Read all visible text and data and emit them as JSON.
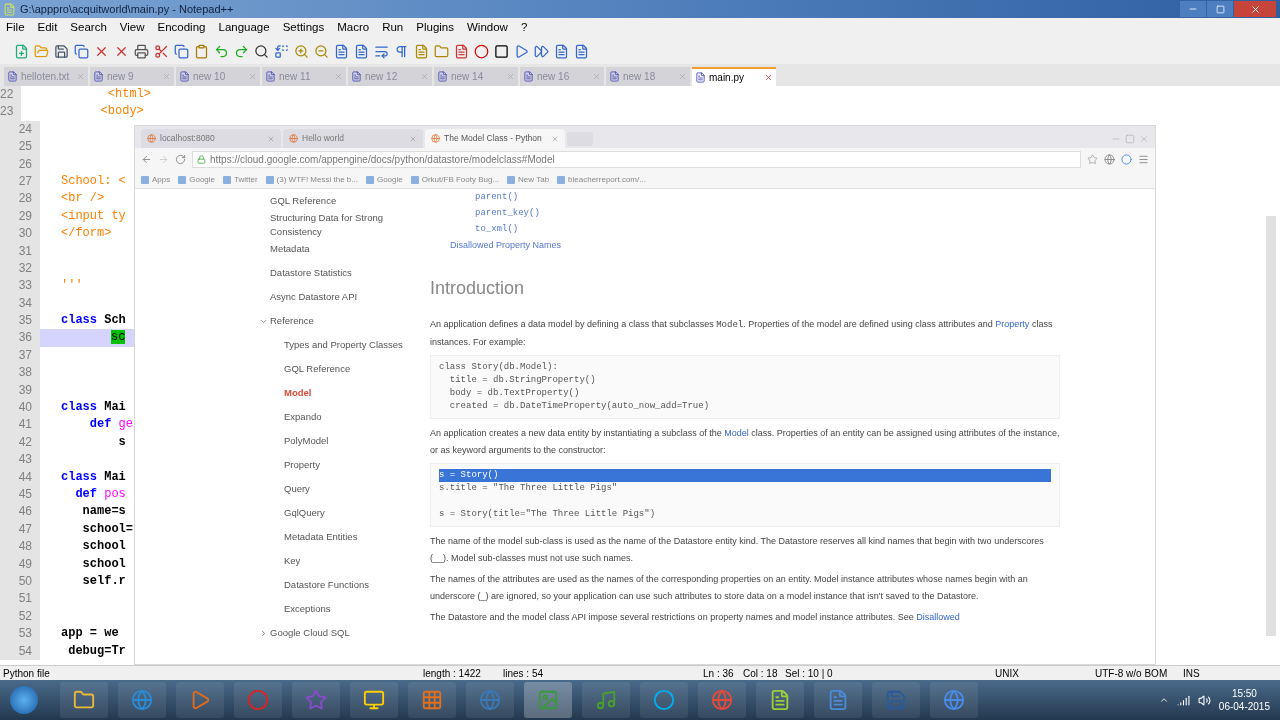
{
  "window": {
    "title": "G:\\apppro\\acquitworld\\main.py - Notepad++"
  },
  "menu": [
    "File",
    "Edit",
    "Search",
    "View",
    "Encoding",
    "Language",
    "Settings",
    "Macro",
    "Run",
    "Plugins",
    "Window",
    "?"
  ],
  "file_tabs": [
    {
      "label": "helloten.txt",
      "selected": false
    },
    {
      "label": "new 9",
      "selected": false
    },
    {
      "label": "new 10",
      "selected": false
    },
    {
      "label": "new 11",
      "selected": false
    },
    {
      "label": "new 12",
      "selected": false
    },
    {
      "label": "new 14",
      "selected": false
    },
    {
      "label": "new 16",
      "selected": false
    },
    {
      "label": "new 18",
      "selected": false
    },
    {
      "label": "main.py",
      "selected": true
    }
  ],
  "editor": {
    "lines": [
      {
        "num": "22",
        "current": false,
        "segments": [
          {
            "text": "            <html>",
            "kind": "tag"
          }
        ]
      },
      {
        "num": "23",
        "current": false,
        "segments": [
          {
            "text": "           <body>",
            "kind": "tag"
          }
        ]
      },
      {
        "num": "24",
        "current": false
      },
      {
        "num": "25",
        "current": false
      },
      {
        "num": "26",
        "current": false
      },
      {
        "num": "27",
        "current": false,
        "segments": [
          {
            "text": "School: <",
            "kind": "tag"
          }
        ]
      },
      {
        "num": "28",
        "current": false,
        "segments": [
          {
            "text": "<br />",
            "kind": "tag"
          }
        ]
      },
      {
        "num": "29",
        "current": false,
        "segments": [
          {
            "text": "<input ty",
            "kind": "tag"
          }
        ]
      },
      {
        "num": "30",
        "current": false,
        "segments": [
          {
            "text": "</form>",
            "kind": "tag"
          }
        ]
      },
      {
        "num": "31",
        "current": false
      },
      {
        "num": "32",
        "current": false
      },
      {
        "num": "33",
        "current": false,
        "segments": [
          {
            "text": "'''",
            "kind": "tag"
          }
        ]
      },
      {
        "num": "34",
        "current": false
      },
      {
        "num": "35",
        "current": false,
        "segments": [
          {
            "text": "class",
            "kind": "keyword"
          },
          {
            "text": " Sch",
            "kind": "plain"
          }
        ]
      },
      {
        "num": "36",
        "current": true,
        "segments": [
          {
            "text": "sc",
            "kind": "match"
          }
        ]
      },
      {
        "num": "37",
        "current": false
      },
      {
        "num": "38",
        "current": false
      },
      {
        "num": "39",
        "current": false
      },
      {
        "num": "40",
        "current": false,
        "segments": [
          {
            "text": "class",
            "kind": "keyword"
          },
          {
            "text": " Mai",
            "kind": "plain"
          }
        ]
      },
      {
        "num": "41",
        "current": false,
        "segments": [
          {
            "text": "    def",
            "kind": "keyword"
          },
          {
            "text": " ge",
            "kind": "func"
          }
        ]
      },
      {
        "num": "42",
        "current": false,
        "segments": [
          {
            "text": "        s",
            "kind": "plain"
          }
        ]
      },
      {
        "num": "43",
        "current": false
      },
      {
        "num": "44",
        "current": false,
        "segments": [
          {
            "text": "class",
            "kind": "keyword"
          },
          {
            "text": " Mai",
            "kind": "plain"
          }
        ]
      },
      {
        "num": "45",
        "current": false,
        "segments": [
          {
            "text": "  def",
            "kind": "keyword"
          },
          {
            "text": " pos",
            "kind": "func"
          }
        ]
      },
      {
        "num": "46",
        "current": false,
        "segments": [
          {
            "text": "   name=s",
            "kind": "plain"
          }
        ]
      },
      {
        "num": "47",
        "current": false,
        "segments": [
          {
            "text": "   school=",
            "kind": "plain"
          }
        ]
      },
      {
        "num": "48",
        "current": false,
        "segments": [
          {
            "text": "   school",
            "kind": "plain"
          }
        ]
      },
      {
        "num": "49",
        "current": false,
        "segments": [
          {
            "text": "   school",
            "kind": "plain"
          }
        ]
      },
      {
        "num": "50",
        "current": false,
        "segments": [
          {
            "text": "   self.r",
            "kind": "plain"
          }
        ]
      },
      {
        "num": "51",
        "current": false
      },
      {
        "num": "52",
        "current": false
      },
      {
        "num": "53",
        "current": false,
        "segments": [
          {
            "text": "app = we",
            "kind": "plain"
          }
        ]
      },
      {
        "num": "54",
        "current": false,
        "segments": [
          {
            "text": " debug=Tr",
            "kind": "plain"
          }
        ]
      }
    ]
  },
  "browser": {
    "tabs": [
      {
        "label": "localhost:8080",
        "selected": false
      },
      {
        "label": "Hello world",
        "selected": false
      },
      {
        "label": "The Model Class - Python",
        "selected": true
      }
    ],
    "url": "https://cloud.google.com/appengine/docs/python/datastore/modelclass#Model",
    "bookmarks": [
      "Apps",
      "Google",
      "Twitter",
      "(3) WTF! Messi the b...",
      "Google",
      "Orkut/FB Footy Bug...",
      "New Tab",
      "bleacherreport.com/..."
    ],
    "nav": [
      {
        "label": "GQL Reference",
        "selected": false
      },
      {
        "label": "Structuring Data for Strong Consistency",
        "selected": false
      },
      {
        "label": "Metadata",
        "selected": false
      },
      {
        "label": "Datastore Statistics",
        "selected": false
      },
      {
        "label": "Async Datastore API",
        "selected": false
      },
      {
        "label": "Reference",
        "selected": false,
        "expanded": true,
        "children": [
          {
            "label": "Types and Property Classes",
            "selected": false
          },
          {
            "label": "GQL Reference",
            "selected": false
          },
          {
            "label": "Model",
            "selected": true
          },
          {
            "label": "Expando",
            "selected": false
          },
          {
            "label": "PolyModel",
            "selected": false
          },
          {
            "label": "Property",
            "selected": false
          },
          {
            "label": "Query",
            "selected": false
          },
          {
            "label": "GqlQuery",
            "selected": false
          },
          {
            "label": "Metadata Entities",
            "selected": false
          },
          {
            "label": "Key",
            "selected": false
          },
          {
            "label": "Datastore Functions",
            "selected": false
          },
          {
            "label": "Exceptions",
            "selected": false
          }
        ]
      },
      {
        "label": "Google Cloud SQL",
        "selected": false,
        "expanded": false
      }
    ],
    "toc_links": [
      "parent()",
      "parent_key()",
      "to_xml()"
    ],
    "toc_section": "Disallowed Property Names",
    "heading": "Introduction",
    "blocks": [
      {
        "kind": "para",
        "segments": [
          {
            "text": "An application defines a data model by defining a class that subclasses ",
            "kind": "plain"
          },
          {
            "text": "Model",
            "kind": "code"
          },
          {
            "text": ". Properties of the model are defined using class attributes and ",
            "kind": "plain"
          },
          {
            "text": "Property",
            "kind": "link"
          },
          {
            "text": " class instances. For example:",
            "kind": "plain"
          }
        ]
      },
      {
        "kind": "code",
        "groups": [
          {
            "lines": [
              {
                "text": "class Story(db.Model):",
                "highlighted": false
              },
              {
                "text": "  title = db.StringProperty()",
                "highlighted": false
              },
              {
                "text": "  body = db.TextProperty()",
                "highlighted": false
              },
              {
                "text": "  created = db.DateTimeProperty(auto_now_add=True)",
                "highlighted": false
              }
            ]
          }
        ]
      },
      {
        "kind": "para",
        "segments": [
          {
            "text": "An application creates a new data entity by instantiating a subclass of the ",
            "kind": "plain"
          },
          {
            "text": "Model",
            "kind": "link"
          },
          {
            "text": " class. Properties of an entity can be assigned using attributes of the instance, or as keyword arguments to the constructor:",
            "kind": "plain"
          }
        ]
      },
      {
        "kind": "code",
        "groups": [
          {
            "lines": [
              {
                "text": "s = Story()",
                "highlighted": true
              },
              {
                "text": "s.title = \"The Three Little Pigs\"",
                "highlighted": false
              }
            ]
          },
          {
            "lines": [
              {
                "text": "s = Story(title=\"The Three Little Pigs\")",
                "highlighted": false
              }
            ]
          }
        ]
      },
      {
        "kind": "para",
        "segments": [
          {
            "text": "The name of the model sub-class is used as the name of the Datastore entity kind. The Datastore reserves all kind names that begin with two underscores (__). Model sub-classes must not use such names.",
            "kind": "plain"
          }
        ]
      },
      {
        "kind": "para",
        "segments": [
          {
            "text": "The names of the attributes are used as the names of the corresponding properties on an entity. Model instance attributes whose names begin with an underscore (_) are ignored, so your application can use such attributes to store data on a model instance that isn't saved to the Datastore.",
            "kind": "plain"
          }
        ]
      },
      {
        "kind": "para",
        "segments": [
          {
            "text": "The Datastore and the model class API impose several restrictions on property names and model instance attributes. See ",
            "kind": "plain"
          },
          {
            "text": "Disallowed",
            "kind": "link"
          }
        ]
      }
    ]
  },
  "status_bar": [
    "Python file",
    "length : 1422",
    "lines : 54",
    "Ln : 36",
    "Col : 18",
    "Sel : 10 | 0",
    "UNIX",
    "UTF-8 w/o BOM",
    "INS"
  ],
  "clock": {
    "time": "15:50",
    "date": "06-04-2015"
  }
}
